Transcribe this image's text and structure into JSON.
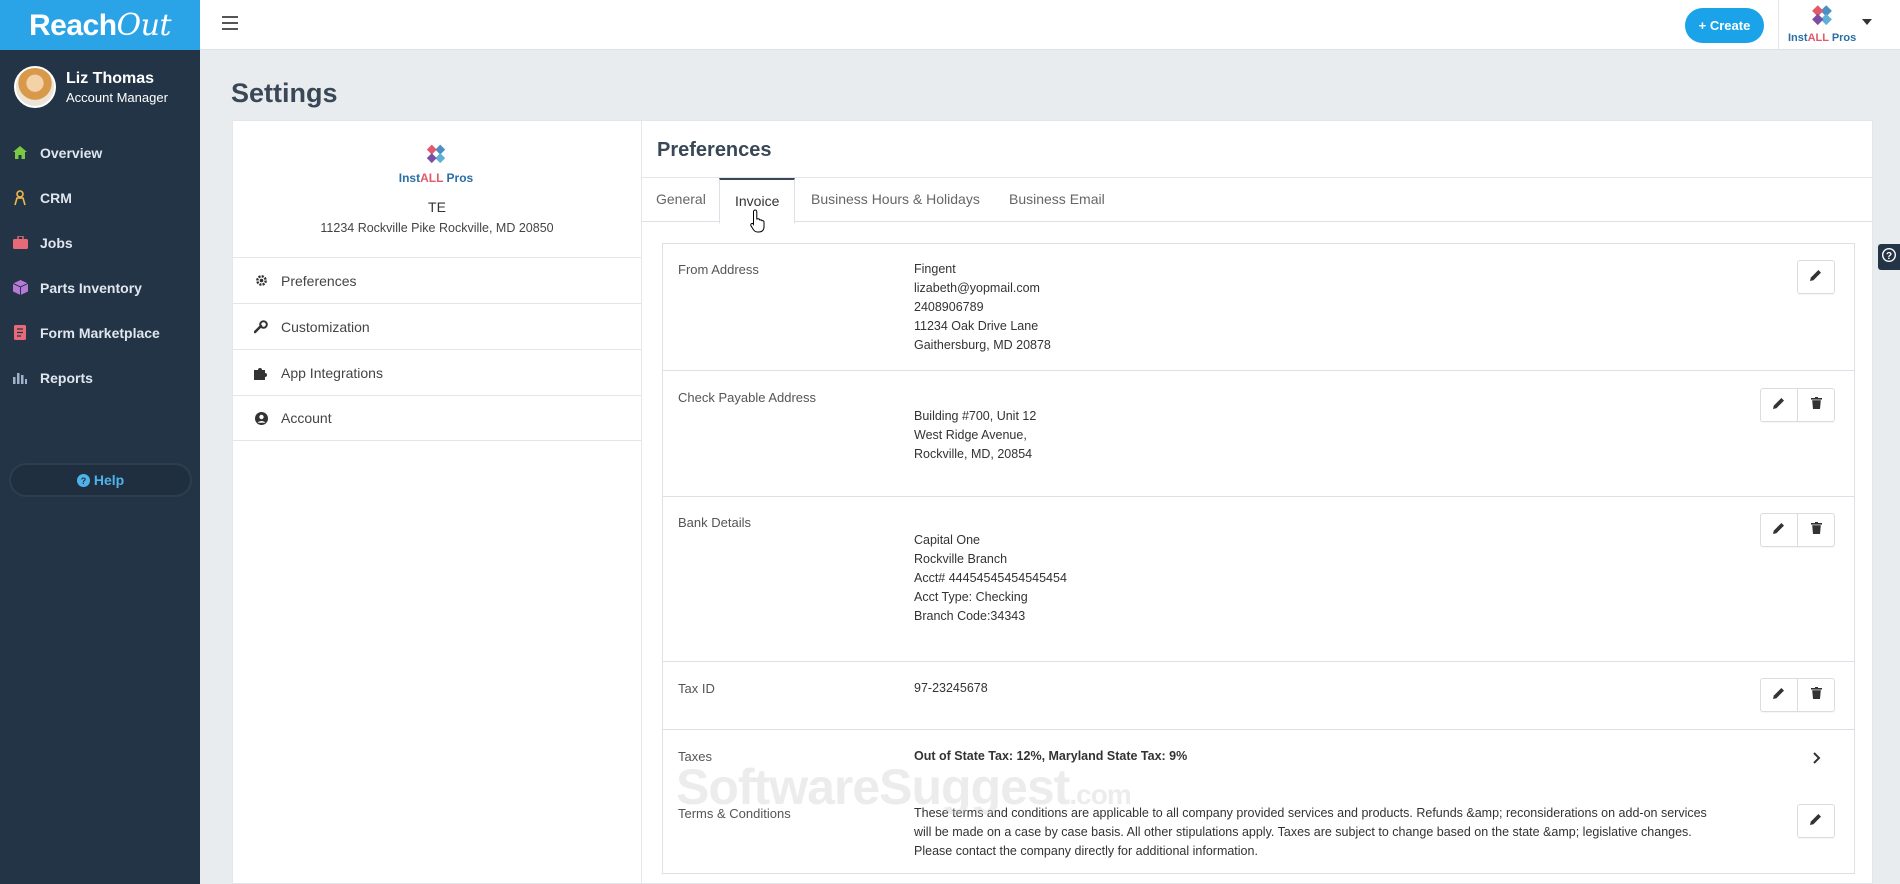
{
  "brand": {
    "name_part1": "Reach",
    "name_part2": "Out"
  },
  "user": {
    "name": "Liz Thomas",
    "role": "Account Manager"
  },
  "sidebar": {
    "items": [
      {
        "label": "Overview",
        "icon": "home-icon"
      },
      {
        "label": "CRM",
        "icon": "crm-icon"
      },
      {
        "label": "Jobs",
        "icon": "briefcase-icon"
      },
      {
        "label": "Parts Inventory",
        "icon": "box-icon"
      },
      {
        "label": "Form Marketplace",
        "icon": "form-icon"
      },
      {
        "label": "Reports",
        "icon": "bar-chart-icon"
      }
    ],
    "help_label": "Help"
  },
  "topbar": {
    "create_label": "+ Create"
  },
  "logo": {
    "word1": "Inst",
    "word2": "ALL",
    "word3": "Pros"
  },
  "page": {
    "title": "Settings"
  },
  "company": {
    "code": "TE",
    "address": "11234 Rockville Pike Rockville, MD 20850"
  },
  "settings_menu": [
    {
      "label": "Preferences",
      "icon": "gear-icon"
    },
    {
      "label": "Customization",
      "icon": "wrench-icon"
    },
    {
      "label": "App Integrations",
      "icon": "puzzle-icon"
    },
    {
      "label": "Account",
      "icon": "user-circle-icon"
    }
  ],
  "preferences": {
    "title": "Preferences",
    "tabs": [
      "General",
      "Invoice",
      "Business Hours & Holidays",
      "Business Email"
    ],
    "active_tab": "Invoice"
  },
  "invoice": {
    "from_address": {
      "label": "From Address",
      "lines": [
        "Fingent",
        "lizabeth@yopmail.com",
        "2408906789",
        "11234 Oak Drive Lane",
        "Gaithersburg, MD 20878"
      ]
    },
    "check_payable": {
      "label": "Check Payable Address",
      "lines": [
        "Building #700, Unit 12",
        "West Ridge Avenue,",
        "Rockville, MD, 20854"
      ]
    },
    "bank_details": {
      "label": "Bank Details",
      "lines": [
        "Capital One",
        "Rockville Branch",
        "Acct# 44454545454545454",
        "Acct Type: Checking",
        "Branch Code:34343"
      ]
    },
    "tax_id": {
      "label": "Tax ID",
      "value": "97-23245678"
    },
    "taxes": {
      "label": "Taxes",
      "value": "Out of State Tax: 12%, Maryland State Tax: 9%"
    },
    "terms": {
      "label": "Terms & Conditions",
      "lines": [
        "These terms and conditions are applicable to all company provided services and products. Refunds &amp; reconsiderations on add-on services",
        "will be made on a case by case basis. All other stipulations apply. Taxes are subject to change based on the state &amp; legislative changes.",
        "Please contact the company directly for additional information."
      ]
    }
  },
  "watermark": {
    "text": "SoftwareSuggest",
    "suffix": ".com"
  },
  "colors": {
    "sidebar": "#243447",
    "brand": "#2aa4e6",
    "accent": "#1aa3e8"
  }
}
